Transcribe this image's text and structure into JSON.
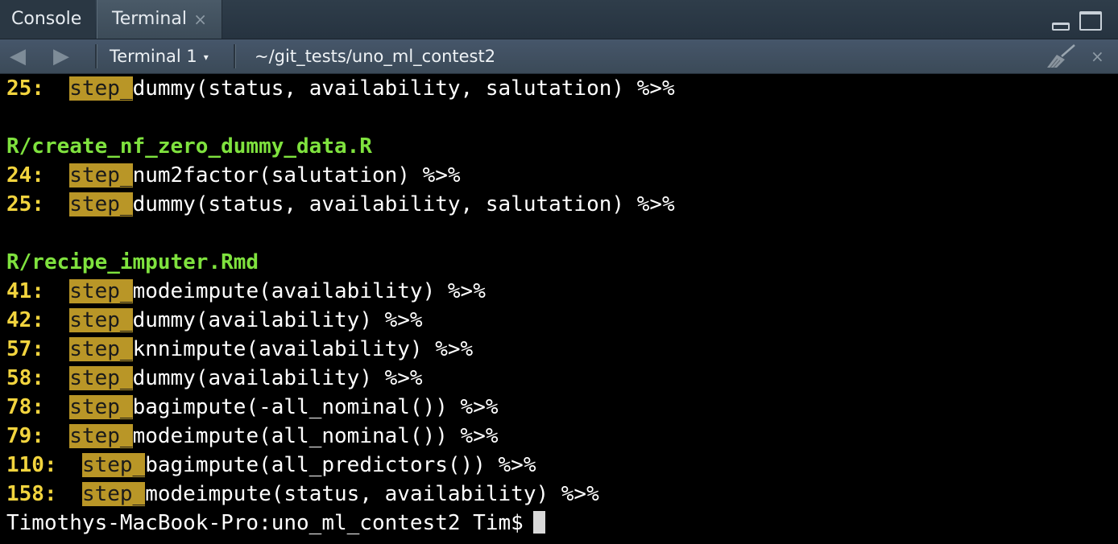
{
  "tabs": {
    "console_label": "Console",
    "terminal_label": "Terminal",
    "terminal_close": "×"
  },
  "toolbar": {
    "back_icon": "◀",
    "forward_icon": "▶",
    "terminal_name": "Terminal 1",
    "caret": "▾",
    "path": "~/git_tests/uno_ml_contest2",
    "close": "×"
  },
  "colors": {
    "line_number": "#f2d43e",
    "match_highlight": "#b99627",
    "filename": "#7fe23e",
    "text": "#ffffff"
  },
  "output": [
    {
      "type": "match",
      "lnum": "25:",
      "pad": "  ",
      "match": "step_",
      "rest": "dummy(status, availability, salutation) %>%"
    },
    {
      "type": "blank"
    },
    {
      "type": "file",
      "text": "R/create_nf_zero_dummy_data.R"
    },
    {
      "type": "match",
      "lnum": "24:",
      "pad": "  ",
      "match": "step_",
      "rest": "num2factor(salutation) %>%"
    },
    {
      "type": "match",
      "lnum": "25:",
      "pad": "  ",
      "match": "step_",
      "rest": "dummy(status, availability, salutation) %>%"
    },
    {
      "type": "blank"
    },
    {
      "type": "file",
      "text": "R/recipe_imputer.Rmd"
    },
    {
      "type": "match",
      "lnum": "41:",
      "pad": "  ",
      "match": "step_",
      "rest": "modeimpute(availability) %>%"
    },
    {
      "type": "match",
      "lnum": "42:",
      "pad": "  ",
      "match": "step_",
      "rest": "dummy(availability) %>%"
    },
    {
      "type": "match",
      "lnum": "57:",
      "pad": "  ",
      "match": "step_",
      "rest": "knnimpute(availability) %>%"
    },
    {
      "type": "match",
      "lnum": "58:",
      "pad": "  ",
      "match": "step_",
      "rest": "dummy(availability) %>%"
    },
    {
      "type": "match",
      "lnum": "78:",
      "pad": "  ",
      "match": "step_",
      "rest": "bagimpute(-all_nominal()) %>%"
    },
    {
      "type": "match",
      "lnum": "79:",
      "pad": "  ",
      "match": "step_",
      "rest": "modeimpute(all_nominal()) %>%"
    },
    {
      "type": "match",
      "lnum": "110:",
      "pad": "  ",
      "match": "step_",
      "rest": "bagimpute(all_predictors()) %>%"
    },
    {
      "type": "match",
      "lnum": "158:",
      "pad": "  ",
      "match": "step_",
      "rest": "modeimpute(status, availability) %>%"
    },
    {
      "type": "prompt",
      "text": "Timothys-MacBook-Pro:uno_ml_contest2 Tim$"
    }
  ]
}
